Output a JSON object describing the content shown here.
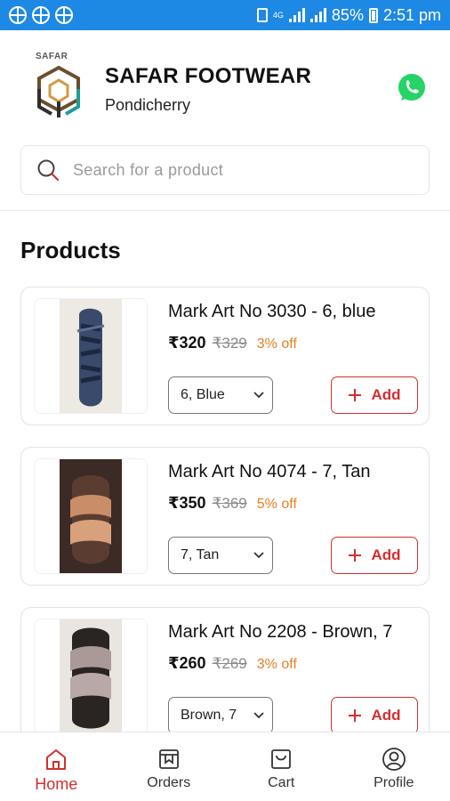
{
  "status_bar": {
    "network_label": "4G",
    "battery": "85%",
    "time": "2:51 pm"
  },
  "store": {
    "logo_text": "SAFAR",
    "name": "SAFAR FOOTWEAR",
    "location": "Pondicherry"
  },
  "search": {
    "placeholder": "Search for a product"
  },
  "section_title": "Products",
  "products": [
    {
      "name": "Mark Art No 3030 - 6, blue",
      "price": "₹320",
      "mrp": "₹329",
      "discount": "3% off",
      "variant": "6, Blue",
      "add_label": "Add"
    },
    {
      "name": "Mark Art No 4074 - 7, Tan",
      "price": "₹350",
      "mrp": "₹369",
      "discount": "5% off",
      "variant": "7, Tan",
      "add_label": "Add"
    },
    {
      "name": "Mark Art No 2208 - Brown, 7",
      "price": "₹260",
      "mrp": "₹269",
      "discount": "3% off",
      "variant": "Brown, 7",
      "add_label": "Add"
    }
  ],
  "bottom_nav": {
    "items": [
      {
        "label": "Home",
        "icon": "home-icon",
        "active": true
      },
      {
        "label": "Orders",
        "icon": "orders-icon",
        "active": false
      },
      {
        "label": "Cart",
        "icon": "cart-icon",
        "active": false
      },
      {
        "label": "Profile",
        "icon": "profile-icon",
        "active": false
      }
    ]
  },
  "colors": {
    "status_bar": "#1e88e5",
    "accent": "#d32f2f",
    "discount": "#e67e22",
    "whatsapp": "#25d366"
  }
}
